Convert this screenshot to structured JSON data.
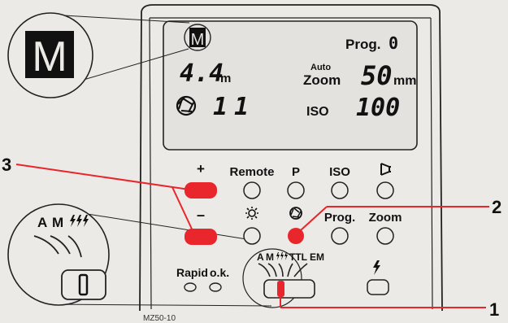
{
  "display": {
    "mode_letter": "M",
    "mode_letter_zoomed": "M",
    "prog_label": "Prog.",
    "prog_value": "0",
    "distance_value": "4.4",
    "distance_unit": "m",
    "zoom_auto": "Auto",
    "zoom_label": "Zoom",
    "zoom_value": "50",
    "zoom_unit": "mm",
    "aperture_value": "11",
    "iso_label": "ISO",
    "iso_value": "100"
  },
  "buttons": {
    "plus": "+",
    "minus": "–",
    "remote": "Remote",
    "p": "P",
    "iso": "ISO",
    "prog": "Prog.",
    "zoom": "Zoom"
  },
  "switch": {
    "modes": [
      "A",
      "M",
      "TTL",
      "EM"
    ],
    "zoom_modes": [
      "A",
      "M"
    ],
    "rapid": "Rapid",
    "ok": "o.k."
  },
  "callouts": [
    "3",
    "2",
    "1"
  ],
  "figure_id": "MZ50-10",
  "colors": {
    "accent": "#e8262b",
    "ink": "#111111",
    "paper": "#eceae6",
    "lcd": "#e4e2de"
  },
  "icons": [
    "aperture-icon",
    "sun-icon",
    "zoom-head-icon",
    "flash-bolt-icon",
    "multi-flash-icon"
  ]
}
